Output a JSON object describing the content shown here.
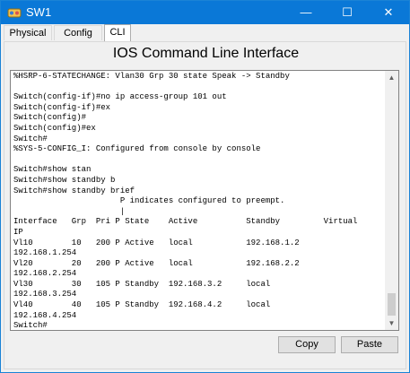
{
  "window": {
    "title": "SW1"
  },
  "titlebar_buttons": {
    "minimize": "—",
    "maximize": "☐",
    "close": "✕"
  },
  "tabs": [
    {
      "label": "Physical"
    },
    {
      "label": "Config"
    },
    {
      "label": "CLI",
      "active": true
    }
  ],
  "cli": {
    "header": "IOS Command Line Interface",
    "lines": [
      "%HSRP-6-STATECHANGE: Vlan30 Grp 30 state Speak -> Standby",
      "",
      "Switch(config-if)#no ip access-group 101 out",
      "Switch(config-if)#ex",
      "Switch(config)#",
      "Switch(config)#ex",
      "Switch#",
      "%SYS-5-CONFIG_I: Configured from console by console",
      "",
      "Switch#show stan",
      "Switch#show standby b",
      "Switch#show standby brief",
      "                      P indicates configured to preempt.",
      "                      |",
      "Interface   Grp  Pri P State    Active          Standby         Virtual",
      "IP",
      "Vl10        10   200 P Active   local           192.168.1.2",
      "192.168.1.254",
      "Vl20        20   200 P Active   local           192.168.2.2",
      "192.168.2.254",
      "Vl30        30   105 P Standby  192.168.3.2     local",
      "192.168.3.254",
      "Vl40        40   105 P Standby  192.168.4.2     local",
      "192.168.4.254",
      "Switch#"
    ]
  },
  "buttons": {
    "copy": "Copy",
    "paste": "Paste"
  },
  "colors": {
    "titlebar": "#0a78d7",
    "terminal_bg": "#ffffff"
  }
}
